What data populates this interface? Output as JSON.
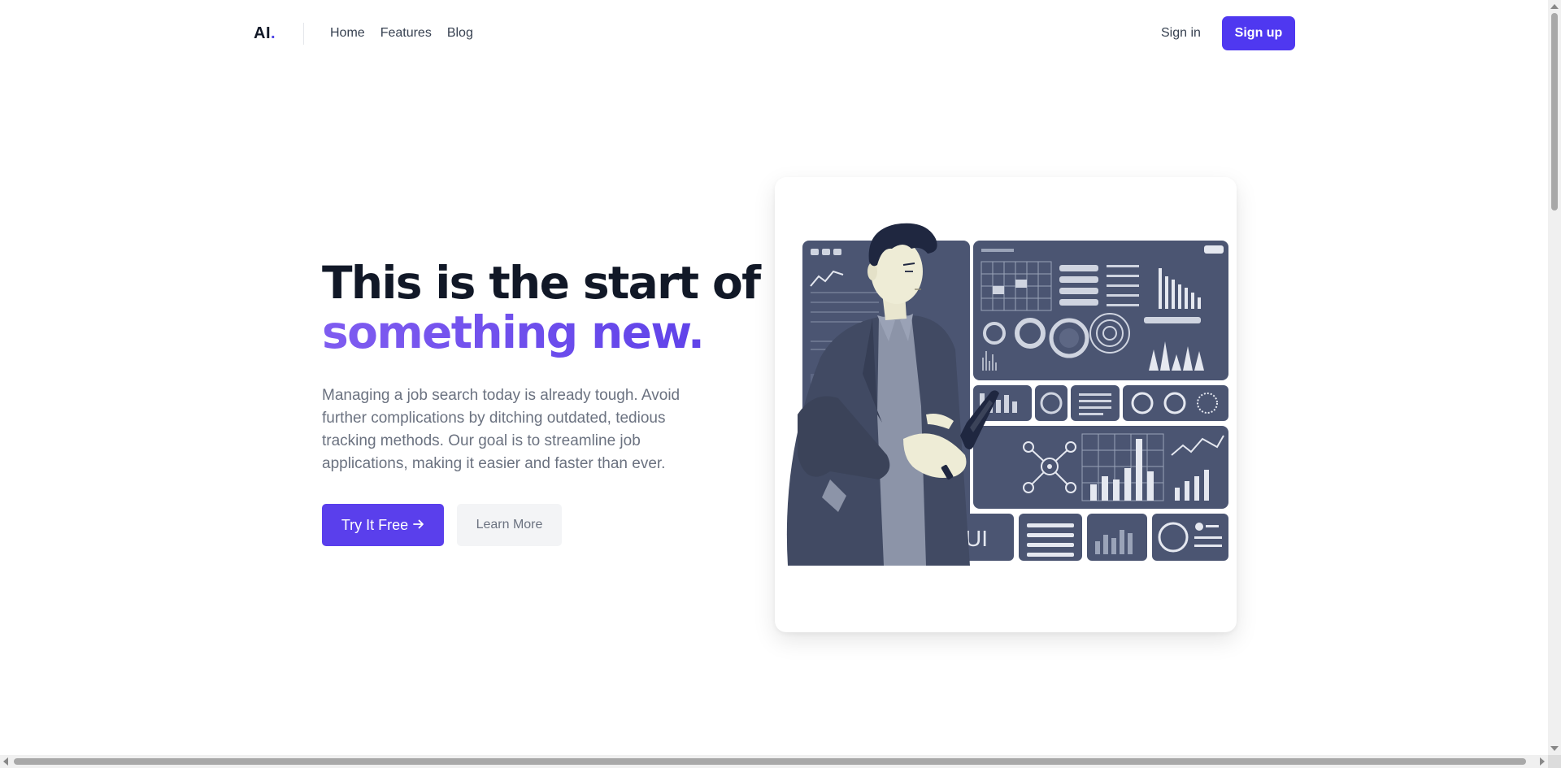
{
  "nav": {
    "logo_text": "AI",
    "logo_dot": ".",
    "links": [
      "Home",
      "Features",
      "Blog"
    ],
    "signin_label": "Sign in",
    "signup_label": "Sign up"
  },
  "hero": {
    "title_line1": "This is the start of",
    "title_line2": "something new.",
    "description": "Managing a job search today is already tough. Avoid further complications by ditching outdated, tedious tracking methods. Our goal is to streamline job applications, making it easier and faster than ever.",
    "primary_button": "Try It Free",
    "primary_button_icon": "arrow-right-icon",
    "secondary_button": "Learn More"
  },
  "illustration": {
    "panel_label": "UI"
  },
  "colors": {
    "brand": "#4f38f0",
    "accent_text": "#6145e6",
    "heading": "#111827",
    "body_text": "#6b7280",
    "illustration_panel": "#4b5572"
  }
}
